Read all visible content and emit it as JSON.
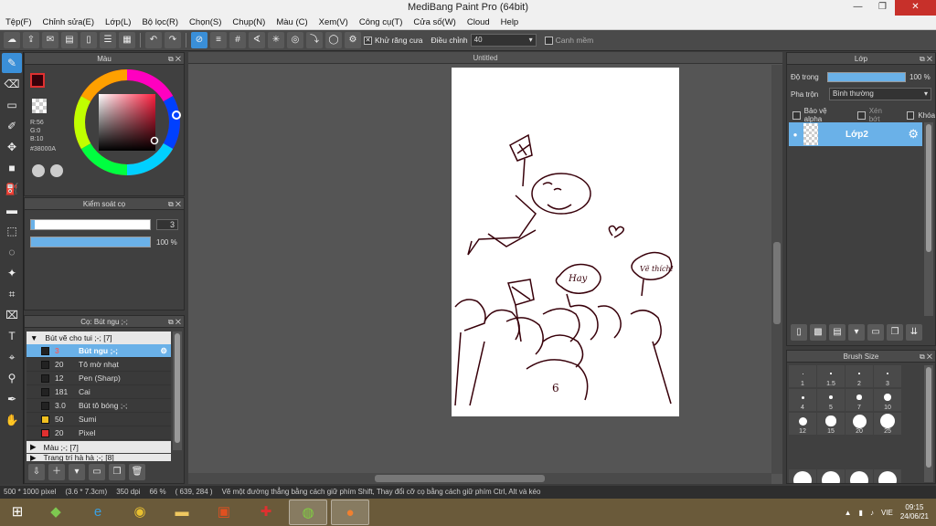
{
  "window": {
    "title": "MediBang Paint Pro (64bit)"
  },
  "menu": [
    "Tệp(F)",
    "Chỉnh sửa(E)",
    "Lớp(L)",
    "Bộ lọc(R)",
    "Chọn(S)",
    "Chụp(N)",
    "Màu (C)",
    "Xem(V)",
    "Công cụ(T)",
    "Cửa số(W)",
    "Cloud",
    "Help"
  ],
  "toolbar": {
    "antialias_label": "Khử răng cưa",
    "correction_label": "Điều chỉnh",
    "correction_value": "40",
    "edge_label": "Canh mềm"
  },
  "color_panel": {
    "title": "Màu",
    "r": "R:56",
    "g": "G:0",
    "b": "B:10",
    "hex": "#38000A",
    "colors": {
      "primary": "#38000A"
    }
  },
  "brush_control": {
    "title": "Kiểm soát cọ",
    "size": "3",
    "opacity": "100 %",
    "opacity_fraction": 1.0,
    "size_fraction": 0.03
  },
  "brush_panel": {
    "title": "Cọ: Bút ngu ;-;",
    "group1": "Bút vẽ cho tui ;-; [7]",
    "brushes": [
      {
        "size": "3",
        "name": "Bút ngu ;-;",
        "color": "#222222",
        "selected": true
      },
      {
        "size": "20",
        "name": "Tô mờ nhạt",
        "color": "#222222"
      },
      {
        "size": "12",
        "name": "Pen (Sharp)",
        "color": "#222222"
      },
      {
        "size": "181",
        "name": "Cai",
        "color": "#222222"
      },
      {
        "size": "3.0",
        "name": "Bút tô bóng ;-;",
        "color": "#222222"
      },
      {
        "size": "50",
        "name": "Sumi",
        "color": "#f0c020"
      },
      {
        "size": "20",
        "name": "Pixel",
        "color": "#e03030"
      }
    ],
    "group2": "Màu ;-; [7]",
    "group3": "Trang trí hà hà ;-; [8]"
  },
  "canvas": {
    "tab": "Untitled"
  },
  "drawing_text": {
    "bubble1": "Hay",
    "bubble2": "Vẽ thích!",
    "shirt": "6"
  },
  "layer_panel": {
    "title": "Lớp",
    "opacity_label": "Độ trong",
    "opacity_value": "100 %",
    "opacity_fraction": 1.0,
    "blend_label": "Pha trộn",
    "blend_value": "Bình thường",
    "protect_alpha": "Bảo vệ alpha",
    "clipping": "Xén bớt",
    "lock": "Khóa",
    "layer_name": "Lớp2"
  },
  "brushsize_panel": {
    "title": "Brush Size",
    "sizes": [
      "1",
      "1.5",
      "2",
      "3",
      "4",
      "5",
      "7",
      "10",
      "12",
      "15",
      "20",
      "25"
    ]
  },
  "status": {
    "dims": "500 * 1000 pixel",
    "cm": "(3.6 * 7.3cm)",
    "dpi": "350 dpi",
    "zoom": "66 %",
    "pos": "( 639, 284 )",
    "hint": "Vẽ một đường thẳng bằng cách giữ phím Shift, Thay đổi cỡ cọ bằng cách giữ phím Ctrl, Alt và kéo"
  },
  "tray": {
    "lang": "VIE",
    "time": "09:15",
    "date": "24/06/21"
  }
}
